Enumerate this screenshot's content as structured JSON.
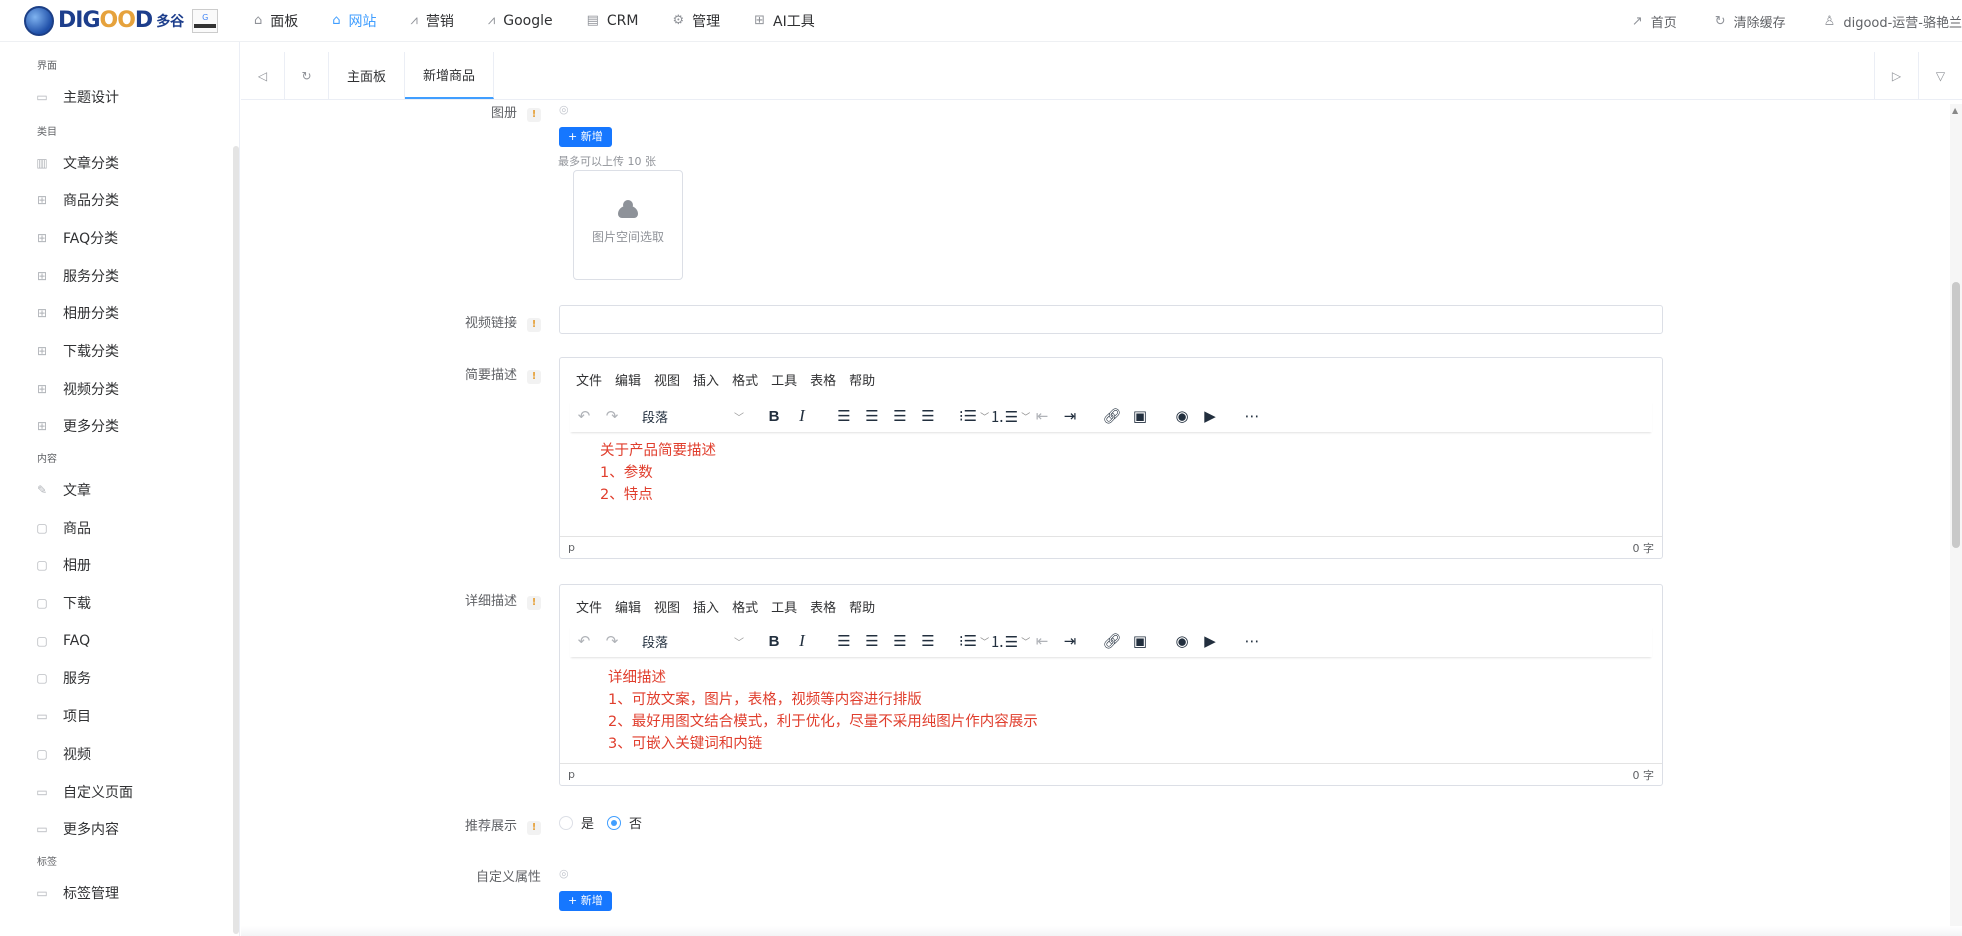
{
  "topbar": {
    "logo_text_1": "DIG",
    "logo_text_2": "OO",
    "logo_text_3": "D",
    "logo_cn": "多谷",
    "nav": [
      {
        "label": "面板",
        "icon": "home-icon"
      },
      {
        "label": "网站",
        "icon": "store-icon"
      },
      {
        "label": "营销",
        "icon": "trend-icon"
      },
      {
        "label": "Google",
        "icon": "trend-icon"
      },
      {
        "label": "CRM",
        "icon": "book-icon"
      },
      {
        "label": "管理",
        "icon": "gear-icon"
      },
      {
        "label": "AI工具",
        "icon": "grid-plus-icon"
      }
    ],
    "right": [
      {
        "label": "首页",
        "icon": "external-link-icon"
      },
      {
        "label": "清除缓存",
        "icon": "refresh-icon"
      },
      {
        "label": "digood-运营-骆艳兰",
        "icon": "user-icon"
      }
    ]
  },
  "sidebar": {
    "groups": [
      {
        "title": "界面",
        "items": [
          "主题设计"
        ]
      },
      {
        "title": "类目",
        "items": [
          "文章分类",
          "商品分类",
          "FAQ分类",
          "服务分类",
          "相册分类",
          "下载分类",
          "视频分类",
          "更多分类"
        ]
      },
      {
        "title": "内容",
        "items": [
          "文章",
          "商品",
          "相册",
          "下载",
          "FAQ",
          "服务",
          "项目",
          "视频",
          "自定义页面",
          "更多内容"
        ]
      },
      {
        "title": "标签",
        "items": [
          "标签管理"
        ]
      }
    ]
  },
  "tabs": {
    "items": [
      "主面板",
      "新增商品"
    ],
    "active": "新增商品"
  },
  "form": {
    "album": {
      "label": "图册",
      "add": "+ 新增",
      "hint": "最多可以上传 10 张",
      "upload": "图片空间选取"
    },
    "video": {
      "label": "视频链接",
      "value": ""
    },
    "brief": {
      "label": "简要描述",
      "lines": [
        "关于产品简要描述",
        "1、参数",
        "2、特点"
      ],
      "status_path": "p",
      "word_count": "0 字"
    },
    "detail": {
      "label": "详细描述",
      "lines": [
        "详细描述",
        "1、可放文案，图片，表格，视频等内容进行排版",
        "2、最好用图文结合模式，利于优化，尽量不采用纯图片作内容展示",
        "3、可嵌入关键词和内链"
      ],
      "status_path": "p",
      "word_count": "0 字"
    },
    "recommend": {
      "label": "推荐展示",
      "options": [
        "是",
        "否"
      ],
      "selected": "否"
    },
    "custom_attr": {
      "label": "自定义属性",
      "add": "+ 新增"
    }
  },
  "editor": {
    "menu": [
      "文件",
      "编辑",
      "视图",
      "插入",
      "格式",
      "工具",
      "表格",
      "帮助"
    ],
    "block_format": "段落"
  },
  "colors": {
    "accent": "#409eff",
    "button": "#1677ff",
    "editor_text": "#e03e2d",
    "required": "#e6a23c"
  }
}
